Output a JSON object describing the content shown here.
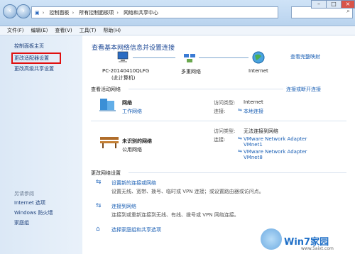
{
  "address": {
    "segments": [
      "控制面板",
      "所有控制面板项",
      "网络和共享中心"
    ]
  },
  "menu": [
    "文件(F)",
    "编辑(E)",
    "查看(V)",
    "工具(T)",
    "帮助(H)"
  ],
  "sidebar": {
    "home": "控制面板主页",
    "items": [
      "更改适配器设置",
      "更改高级共享设置"
    ],
    "see_also_title": "另请参阅",
    "see_also": [
      "Internet 选项",
      "Windows 防火墙",
      "家庭组"
    ]
  },
  "main": {
    "title": "查看基本网络信息并设置连接",
    "full_map": "查看完整映射",
    "map": {
      "pc": "PC-20140410QLFG",
      "pc_sub": "(此计算机)",
      "multi": "多重网络",
      "internet": "Internet"
    },
    "active_title": "查看活动网络",
    "connect_link": "连接或断开连接",
    "network1": {
      "name": "网络",
      "type": "工作网络",
      "access_label": "访问类型:",
      "access_value": "Internet",
      "conn_label": "连接:",
      "conn_value": "本地连接"
    },
    "network2": {
      "name": "未识别的网络",
      "type": "公用网络",
      "access_label": "访问类型:",
      "access_value": "无法连接到网络",
      "conn_label": "连接:",
      "conn_value1": "VMware Network Adapter VMnet1",
      "conn_value2": "VMware Network Adapter VMnet8"
    },
    "change_title": "更改网络设置",
    "tasks": [
      {
        "title": "设置新的连接或网络",
        "desc": "设置无线、宽带、拨号、临时或 VPN 连接；或设置路由器或访问点。"
      },
      {
        "title": "连接到网络",
        "desc": "连接到或重新连接到无线、有线、拨号或 VPN 网络连接。"
      },
      {
        "title": "选择家庭组和共享选项"
      }
    ]
  },
  "watermark": {
    "brand": "Win7家园",
    "url": "www.5aixt.com"
  }
}
